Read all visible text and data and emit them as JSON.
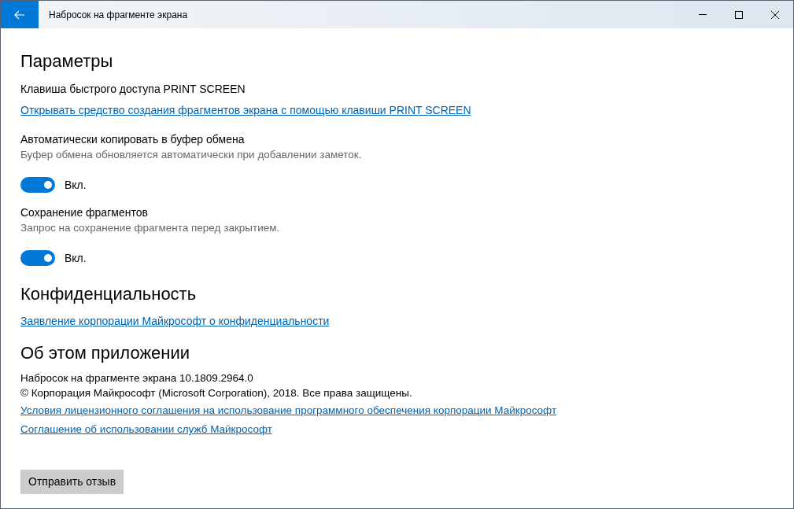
{
  "window": {
    "title": "Набросок на фрагменте экрана"
  },
  "sections": [
    {
      "heading": "Параметры",
      "items": [
        {
          "kind": "label",
          "text": "Клавиша быстрого доступа PRINT SCREEN"
        },
        {
          "kind": "link",
          "text": "Открывать средство создания фрагментов экрана с помощью клавиши PRINT SCREEN"
        },
        {
          "kind": "label",
          "text": "Автоматически копировать в буфер обмена"
        },
        {
          "kind": "description",
          "text": "Буфер обмена обновляется автоматически при добавлении заметок."
        },
        {
          "kind": "toggle",
          "on": true,
          "text": "Вкл."
        },
        {
          "kind": "label",
          "text": "Сохранение фрагментов"
        },
        {
          "kind": "description",
          "text": "Запрос на сохранение фрагмента перед закрытием."
        },
        {
          "kind": "toggle",
          "on": true,
          "text": "Вкл."
        }
      ]
    },
    {
      "heading": "Конфиденциальность",
      "items": [
        {
          "kind": "link",
          "text": "Заявление корпорации Майкрософт о конфиденциальности"
        }
      ]
    },
    {
      "heading": "Об этом приложении",
      "lines": [
        {
          "kind": "text",
          "text": "Набросок на фрагменте экрана 10.1809.2964.0"
        },
        {
          "kind": "text",
          "text": "© Корпорация Майкрософт (Microsoft Corporation), 2018. Все права защищены."
        },
        {
          "kind": "link",
          "text": "Условия лицензионного соглашения на использование программного обеспечения корпорации Майкрософт"
        },
        {
          "kind": "link",
          "text": "Соглашение об использовании служб Майкрософт"
        }
      ]
    }
  ],
  "feedback_button": "Отправить отзыв"
}
